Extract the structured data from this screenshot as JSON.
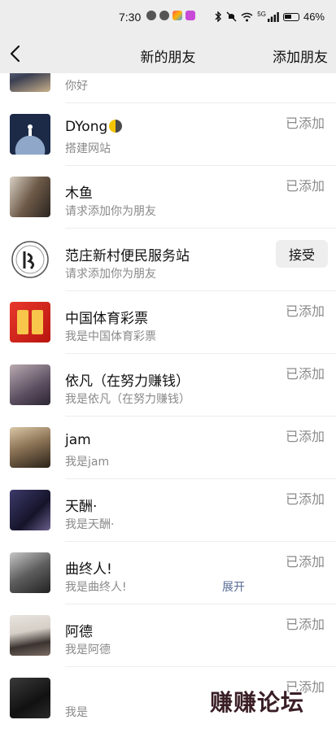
{
  "status_bar": {
    "time": "7:30",
    "network": "5G",
    "battery": "46%",
    "icons": [
      "wechat-icon",
      "qq-icon",
      "app-icon",
      "app-icon",
      "bluetooth-icon",
      "mute-icon",
      "wifi-icon",
      "signal-icon",
      "battery-icon"
    ]
  },
  "nav": {
    "back_icon": "chevron-left-icon",
    "title": "新的朋友",
    "add_label": "添加朋友"
  },
  "contacts": [
    {
      "name": "",
      "message": "你好",
      "status": ""
    },
    {
      "name": "DYong",
      "message": "搭建网站",
      "status": "已添加"
    },
    {
      "name": "木鱼",
      "message": "请求添加你为朋友",
      "status": "已添加"
    },
    {
      "name": "范庄新村便民服务站",
      "message": "请求添加你为朋友",
      "action": "接受"
    },
    {
      "name": "中国体育彩票",
      "message": "我是中国体育彩票",
      "status": "已添加"
    },
    {
      "name": "依凡（在努力赚钱）",
      "message": "我是依凡（在努力赚钱）",
      "status": "已添加"
    },
    {
      "name": "jam",
      "message": "我是jam",
      "status": "已添加"
    },
    {
      "name": "天酬·",
      "message": "我是天酬·",
      "status": "已添加"
    },
    {
      "name": "曲终人!",
      "message": "我是曲终人!",
      "status": "已添加",
      "expand": "展开"
    },
    {
      "name": "阿德",
      "message": "我是阿德",
      "status": "已添加"
    },
    {
      "name": "",
      "message": "我是",
      "status": "已添加"
    }
  ],
  "watermark": "赚赚论坛",
  "colors": {
    "bar_bg": "#ededed",
    "link": "#576b95",
    "secondary_text": "#8a8a8a"
  }
}
